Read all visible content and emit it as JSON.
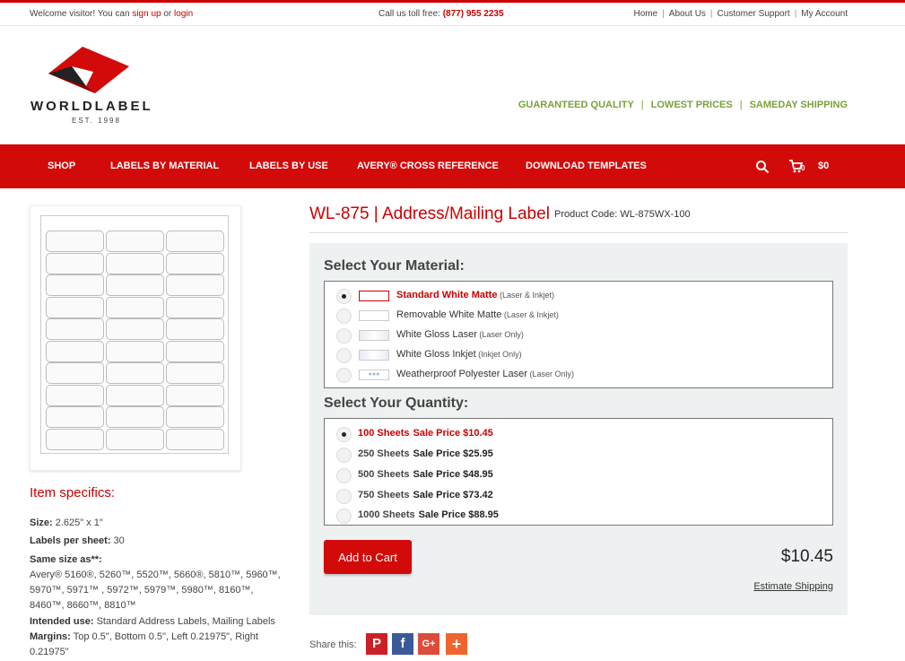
{
  "topbar": {
    "welcome_prefix": "Welcome visitor! You can ",
    "signup": "sign up",
    "or": " or ",
    "login": "login",
    "toll_prefix": "Call us toll free: ",
    "phone": "(877) 955 2235",
    "links": [
      "Home",
      "About Us",
      "Customer Support",
      "My Account"
    ]
  },
  "logo": {
    "wordmark": "WORLDLABEL",
    "est": "EST. 1998"
  },
  "tagline": [
    "GUARANTEED QUALITY",
    "LOWEST PRICES",
    "SAMEDAY SHIPPING"
  ],
  "nav": {
    "items": [
      "SHOP",
      "LABELS BY MATERIAL",
      "LABELS BY USE",
      "AVERY® CROSS REFERENCE",
      "DOWNLOAD TEMPLATES"
    ],
    "cart_count": "0",
    "cart_total": "$0"
  },
  "product": {
    "title": "WL-875 | Address/Mailing Label",
    "code": "Product Code: WL-875WX-100"
  },
  "specs": {
    "title": "Item specifics:",
    "size_label": "Size:",
    "size_value": " 2.625\" x 1\"",
    "per_sheet_label": "Labels per sheet:",
    "per_sheet_value": " 30",
    "same_size_label": "Same size as**:",
    "same_size_value": "Avery® 5160®, 5260™, 5520™, 5660®, 5810™, 5960™, 5970™, 5971™ , 5972™, 5979™, 5980™, 8160™, 8460™, 8660™, 8810™",
    "use_label": "Intended use:",
    "use_value": " Standard Address Labels, Mailing Labels",
    "margins_label": "Margins:",
    "margins_value": " Top 0.5\", Bottom 0.5\", Left 0.21975\", Right 0.21975\""
  },
  "material": {
    "heading": "Select Your Material:",
    "options": [
      {
        "name": "Standard White Matte",
        "note": " (Laser & Inkjet)"
      },
      {
        "name": "Removable White Matte",
        "note": " (Laser & Inkjet)"
      },
      {
        "name": "White Gloss Laser",
        "note": " (Laser Only)"
      },
      {
        "name": "White Gloss Inkjet",
        "note": " (Inkjet Only)"
      },
      {
        "name": "Weatherproof Polyester Laser",
        "note": " (Laser Only)"
      }
    ],
    "selected": 0
  },
  "quantity": {
    "heading": "Select Your Quantity:",
    "options": [
      {
        "sheets": "100 Sheets",
        "price": "Sale Price $10.45"
      },
      {
        "sheets": "250 Sheets",
        "price": "Sale Price $25.95"
      },
      {
        "sheets": "500 Sheets",
        "price": "Sale Price $48.95"
      },
      {
        "sheets": "750 Sheets",
        "price": "Sale Price $73.42"
      },
      {
        "sheets": "1000 Sheets",
        "price": "Sale Price $88.95"
      }
    ],
    "selected": 0
  },
  "cart": {
    "add_label": "Add to Cart",
    "total": "$10.45",
    "estimate_shipping": "Estimate Shipping"
  },
  "share": {
    "label": "Share this:",
    "buttons": [
      {
        "icon": "pinterest-icon",
        "glyph": "P",
        "color": "#cb2027"
      },
      {
        "icon": "facebook-icon",
        "glyph": "f",
        "color": "#3b5998"
      },
      {
        "icon": "google-plus-icon",
        "glyph": "G+",
        "color": "#dd4b39"
      },
      {
        "icon": "add-share-icon",
        "glyph": "+",
        "color": "#f0652f"
      }
    ]
  },
  "colors": {
    "brand_red": "#d20a0a",
    "tagline_green": "#7aa03c",
    "panel_bg": "#eef1f1"
  }
}
